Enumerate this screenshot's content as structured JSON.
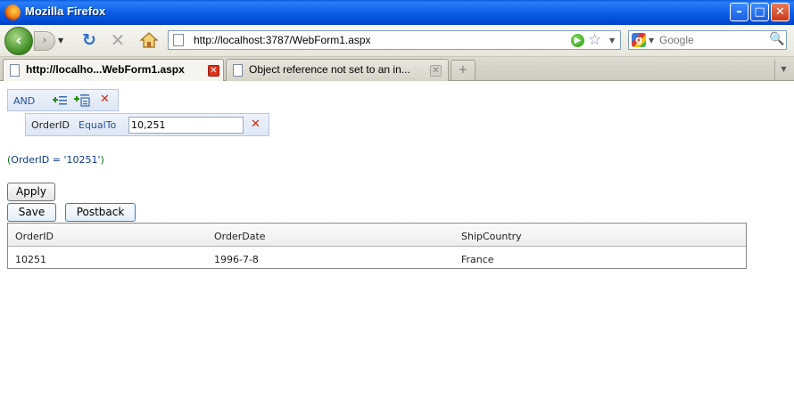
{
  "window": {
    "title": "Mozilla Firefox",
    "minimize": "–",
    "maximize": "□",
    "close": "✕"
  },
  "nav": {
    "back": "‹",
    "forward": "›",
    "url": "http://localhost:3787/WebForm1.aspx",
    "search_placeholder": "Google"
  },
  "tabs": [
    {
      "label": "http://localho...WebForm1.aspx",
      "active": true
    },
    {
      "label": "Object reference not set to an in...",
      "active": false
    }
  ],
  "newtab_label": "+",
  "filter": {
    "group_operator": "AND",
    "condition": {
      "field": "OrderID",
      "operator": "EqualTo",
      "value": "10,251"
    },
    "expression_open": "(",
    "expression_body": "OrderID = '10251'",
    "expression_close": ")"
  },
  "buttons": {
    "apply": "Apply",
    "save": "Save",
    "postback": "Postback"
  },
  "grid": {
    "columns": [
      "OrderID",
      "OrderDate",
      "ShipCountry"
    ],
    "rows": [
      [
        "10251",
        "1996-7-8",
        "France"
      ]
    ]
  }
}
